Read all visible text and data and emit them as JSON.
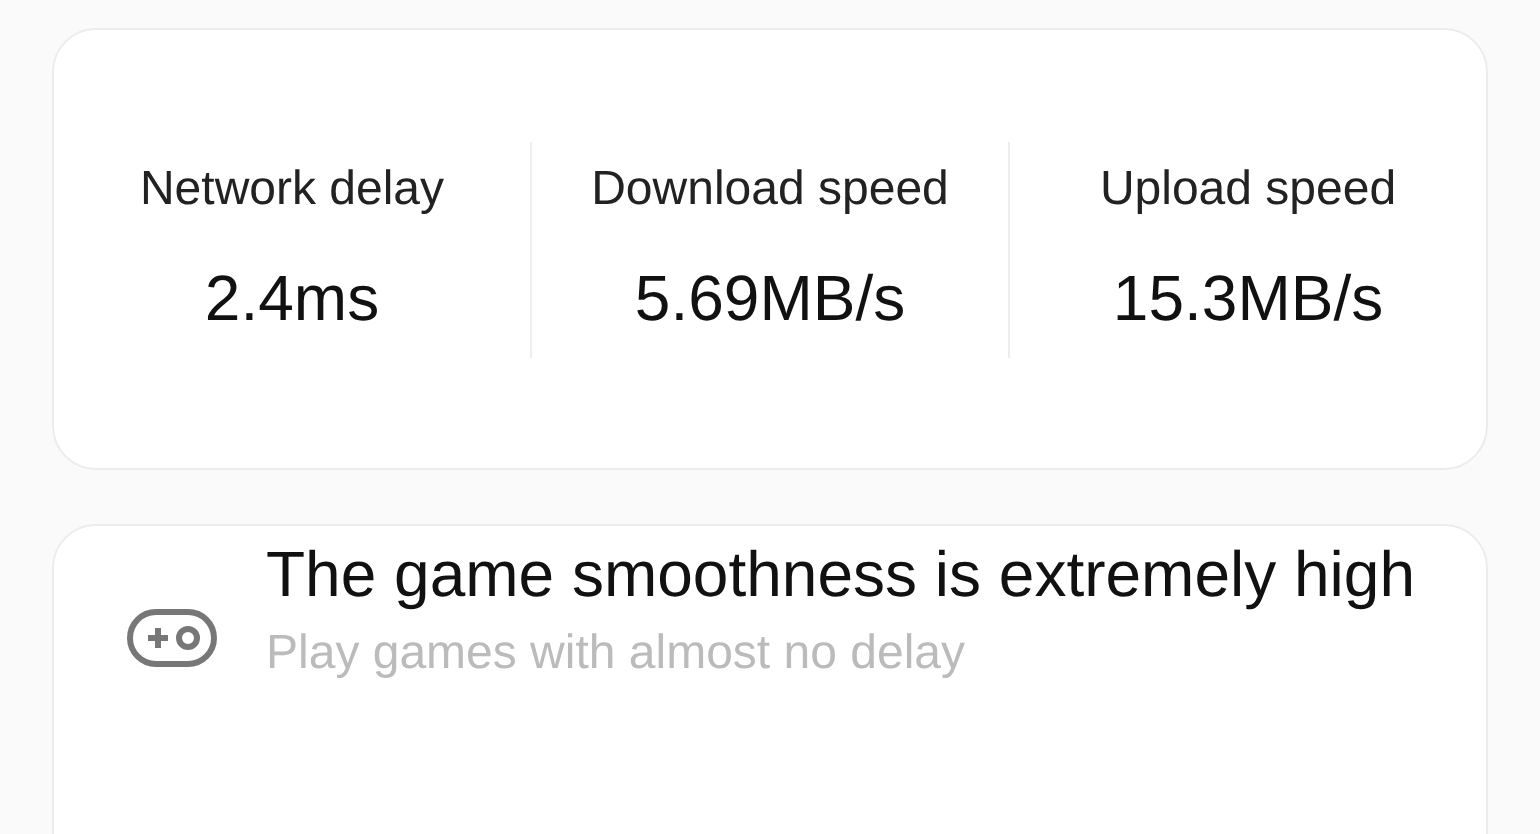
{
  "stats": [
    {
      "label": "Network delay",
      "value": "2.4ms"
    },
    {
      "label": "Download speed",
      "value": "5.69MB/s"
    },
    {
      "label": "Upload speed",
      "value": "15.3MB/s"
    }
  ],
  "status": {
    "title": "The game smoothness is extremely high",
    "subtitle": "Play games with almost no delay"
  }
}
